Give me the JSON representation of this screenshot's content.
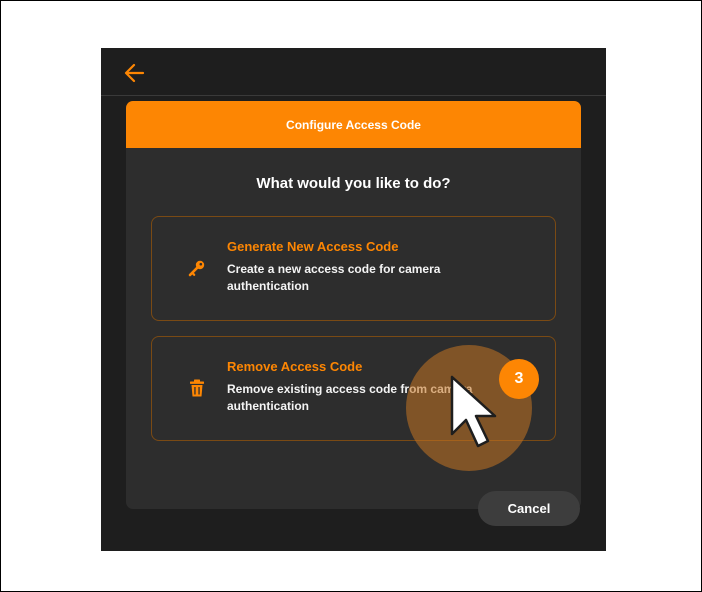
{
  "dialog": {
    "header_title": "Configure Access Code",
    "question": "What would you like to do?",
    "options": [
      {
        "title": "Generate New Access Code",
        "description": "Create a new access code for camera authentication",
        "icon": "key-icon"
      },
      {
        "title": "Remove Access Code",
        "description": "Remove existing access code from camera authentication",
        "icon": "trash-icon"
      }
    ],
    "cancel_label": "Cancel"
  },
  "topbar": {
    "back_icon": "back-arrow-icon"
  },
  "annotation": {
    "step_number": "3"
  },
  "colors": {
    "accent": "#fd8603",
    "background": "#1e1e1e",
    "dialog": "#2d2d2d",
    "option_border": "#7a4a14",
    "text": "#ffffff"
  }
}
